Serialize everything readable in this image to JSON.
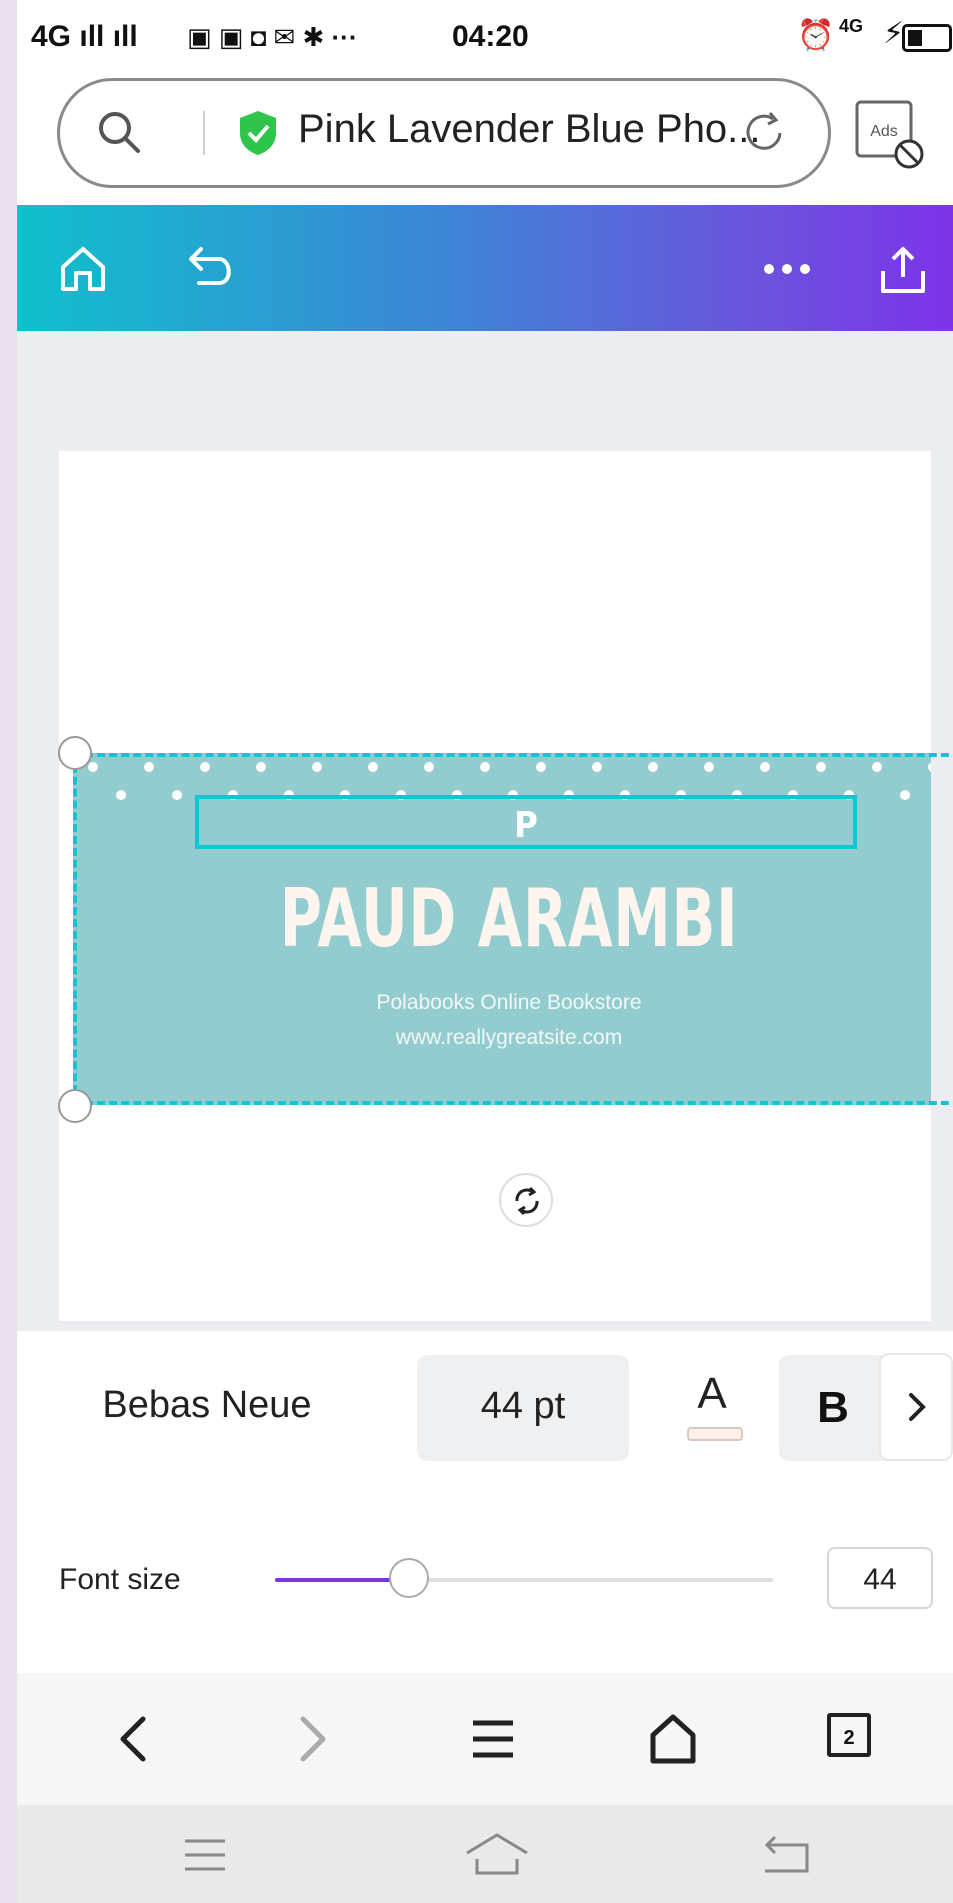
{
  "status_bar": {
    "network": "4G ıll  ıll",
    "time": "04:20",
    "network2": "4G"
  },
  "url_bar": {
    "page_title": "Pink Lavender Blue Pho...",
    "ads_label": "Ads"
  },
  "toolbar": {
    "home_icon": "home-icon",
    "undo_icon": "undo-icon",
    "more_icon": "more-dots-icon",
    "share_icon": "share-icon",
    "gradient_colors": [
      "#10c0cc",
      "#7d33ea"
    ]
  },
  "design": {
    "banner_color": "#93ccce",
    "selected_text": "P",
    "title": "PAUD ARAMBI",
    "subtitle": "Polabooks Online Bookstore",
    "website": "www.reallygreatsite.com"
  },
  "font_toolbar": {
    "font_name": "Bebas Neue",
    "font_size": "44 pt",
    "text_color_letter": "A",
    "bold_label": "B"
  },
  "font_size_slider": {
    "label": "Font size",
    "value": "44",
    "fraction": 0.27,
    "accent": "#7d35e0"
  },
  "browser_nav": {
    "tab_count": "2"
  }
}
